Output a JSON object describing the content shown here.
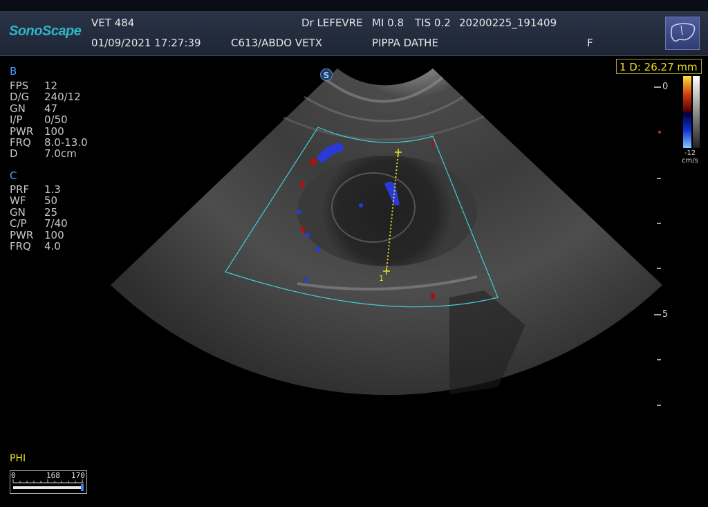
{
  "header": {
    "brand": "SonoScape",
    "patient_id": "VET 484",
    "datetime": "01/09/2021 17:27:39",
    "doctor": "Dr LEFEVRE",
    "probe_preset": "C613/ABDO VETX",
    "mi": "MI  0.8",
    "tis": "TIS 0.2",
    "exam_id": "20200225_191409",
    "patient_name": "PIPPA DATHE",
    "sex": "F",
    "preset_icon": "liver-icon"
  },
  "b_mode": {
    "title": "B",
    "params": [
      {
        "key": "FPS",
        "value": "12"
      },
      {
        "key": "D/G",
        "value": "240/12"
      },
      {
        "key": "GN",
        "value": "47"
      },
      {
        "key": "I/P",
        "value": "0/50"
      },
      {
        "key": "PWR",
        "value": "100"
      },
      {
        "key": "FRQ",
        "value": "8.0-13.0"
      },
      {
        "key": "D",
        "value": "7.0cm"
      }
    ]
  },
  "color_mode": {
    "title": "C",
    "params": [
      {
        "key": "PRF",
        "value": "1.3"
      },
      {
        "key": "WF",
        "value": "50"
      },
      {
        "key": "GN",
        "value": "25"
      },
      {
        "key": "C/P",
        "value": "7/40"
      },
      {
        "key": "PWR",
        "value": "100"
      },
      {
        "key": "FRQ",
        "value": "4.0"
      }
    ]
  },
  "measurement": {
    "label": "1  D: 26.27  mm",
    "caliper_index": "1"
  },
  "color_bar": {
    "top_label": "0",
    "bottom_label": "-12",
    "unit": "cm/s"
  },
  "depth_scale": {
    "labels": [
      "0",
      "5"
    ]
  },
  "phi": {
    "label": "PHI",
    "scale_min": "0",
    "scale_mid": "168",
    "scale_max": "170"
  },
  "focus_marker": "S",
  "colors": {
    "header_bg": "#232c3d",
    "brand": "#2fb5c8",
    "roi_box": "#3fd0d8",
    "caliper": "#e8e020",
    "param_section": "#4aa0ff"
  }
}
